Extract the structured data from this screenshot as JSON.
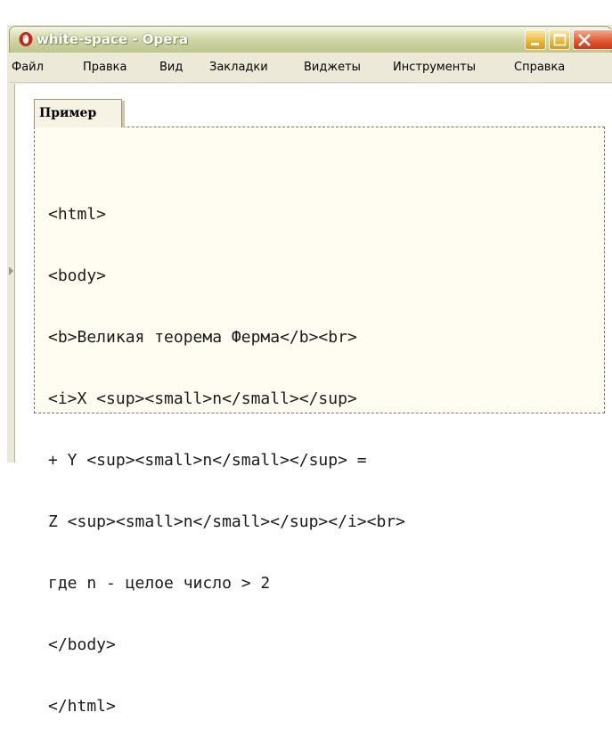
{
  "window": {
    "title": "white-space - Opera",
    "buttons": {
      "minimize": "minimize-icon",
      "maximize": "maximize-icon",
      "close": "close-icon"
    }
  },
  "menu": {
    "items": [
      "Файл",
      "Правка",
      "Вид",
      "Закладки",
      "Виджеты",
      "Инструменты",
      "Справка"
    ]
  },
  "example": {
    "legend": "Пример",
    "code_lines": [
      "<html>",
      "<body>",
      "<b>Великая теорема Ферма</b><br>",
      "<i>X <sup><small>n</small></sup>",
      "+ Y <sup><small>n</small></sup> =",
      "Z <sup><small>n</small></sup></i><br>",
      "где n - целое число > 2",
      "</body>",
      "</html>"
    ]
  },
  "colors": {
    "title_bar": "#bcc58d",
    "code_background": "#fffdf2",
    "close_button": "#e0542c"
  }
}
